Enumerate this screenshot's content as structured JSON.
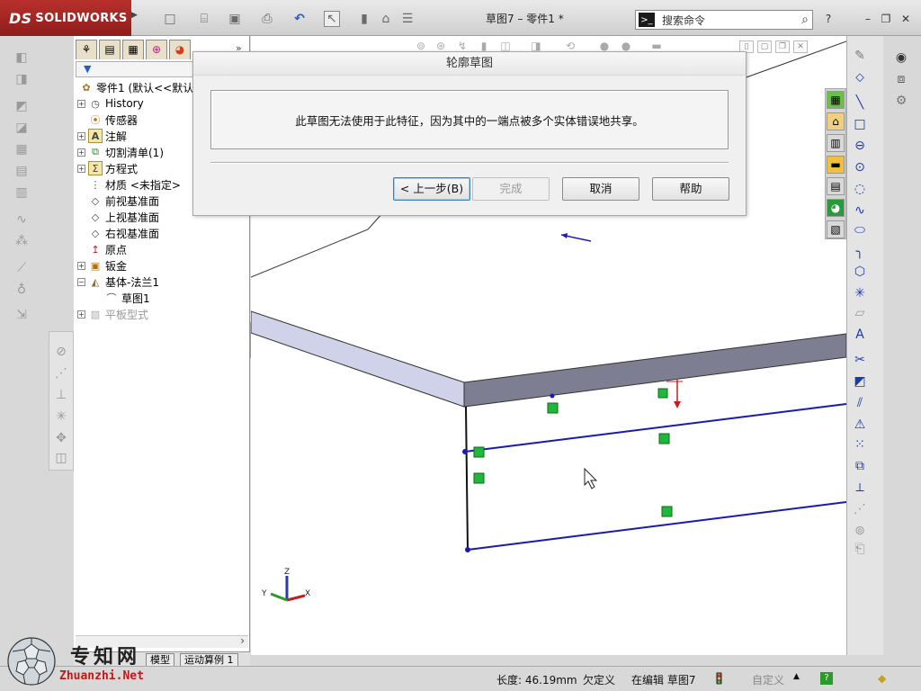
{
  "app": {
    "brand": "SOLIDWORKS",
    "window_title": "草图7 – 零件1 *",
    "search_placeholder": "搜索命令",
    "help_icon": "?",
    "min": "–",
    "restore": "❐",
    "close": "✕"
  },
  "feature_tree": {
    "items": [
      {
        "label": "零件1  (默认<<默认",
        "expander": "",
        "icon": "part-icon"
      },
      {
        "label": "History",
        "expander": "+",
        "icon": "history-icon"
      },
      {
        "label": "传感器",
        "expander": "",
        "icon": "sensor-icon"
      },
      {
        "label": "注解",
        "expander": "+",
        "icon": "annotation-icon"
      },
      {
        "label": "切割清单(1)",
        "expander": "+",
        "icon": "cutlist-icon"
      },
      {
        "label": "方程式",
        "expander": "+",
        "icon": "equation-icon"
      },
      {
        "label": "材质 <未指定>",
        "expander": "",
        "icon": "material-icon"
      },
      {
        "label": "前视基准面",
        "expander": "",
        "icon": "plane-icon"
      },
      {
        "label": "上视基准面",
        "expander": "",
        "icon": "plane-icon"
      },
      {
        "label": "右视基准面",
        "expander": "",
        "icon": "plane-icon"
      },
      {
        "label": "原点",
        "expander": "",
        "icon": "origin-icon"
      },
      {
        "label": "钣金",
        "expander": "+",
        "icon": "sheetmetal-icon"
      },
      {
        "label": "基体-法兰1",
        "expander": "−",
        "icon": "baseflange-icon"
      },
      {
        "label": "草图1",
        "expander": "",
        "icon": "sketch-icon"
      },
      {
        "label": "平板型式",
        "expander": "+",
        "icon": "flatpattern-icon"
      }
    ],
    "tabs": [
      "模型",
      "运动算例 1"
    ]
  },
  "dialog": {
    "title": "轮廓草图",
    "message": "此草图无法使用于此特征，因为其中的一端点被多个实体错误地共享。",
    "btn_back": "< 上一步(B)",
    "btn_finish": "完成",
    "btn_cancel": "取消",
    "btn_help": "帮助"
  },
  "status": {
    "length": "长度: 46.19mm",
    "definition": "欠定义",
    "editing": "在编辑 草图7",
    "custom": "自定义",
    "help": "?"
  },
  "triad": {
    "x": "X",
    "y": "Y",
    "z": "Z"
  },
  "watermark": {
    "title": "专知网",
    "url": "Zhuanzhi.Net"
  },
  "colors": {
    "sketch_line": "#1a1ab0",
    "relation_green": "#1fb83a",
    "solidworks_red": "#b8302c"
  }
}
